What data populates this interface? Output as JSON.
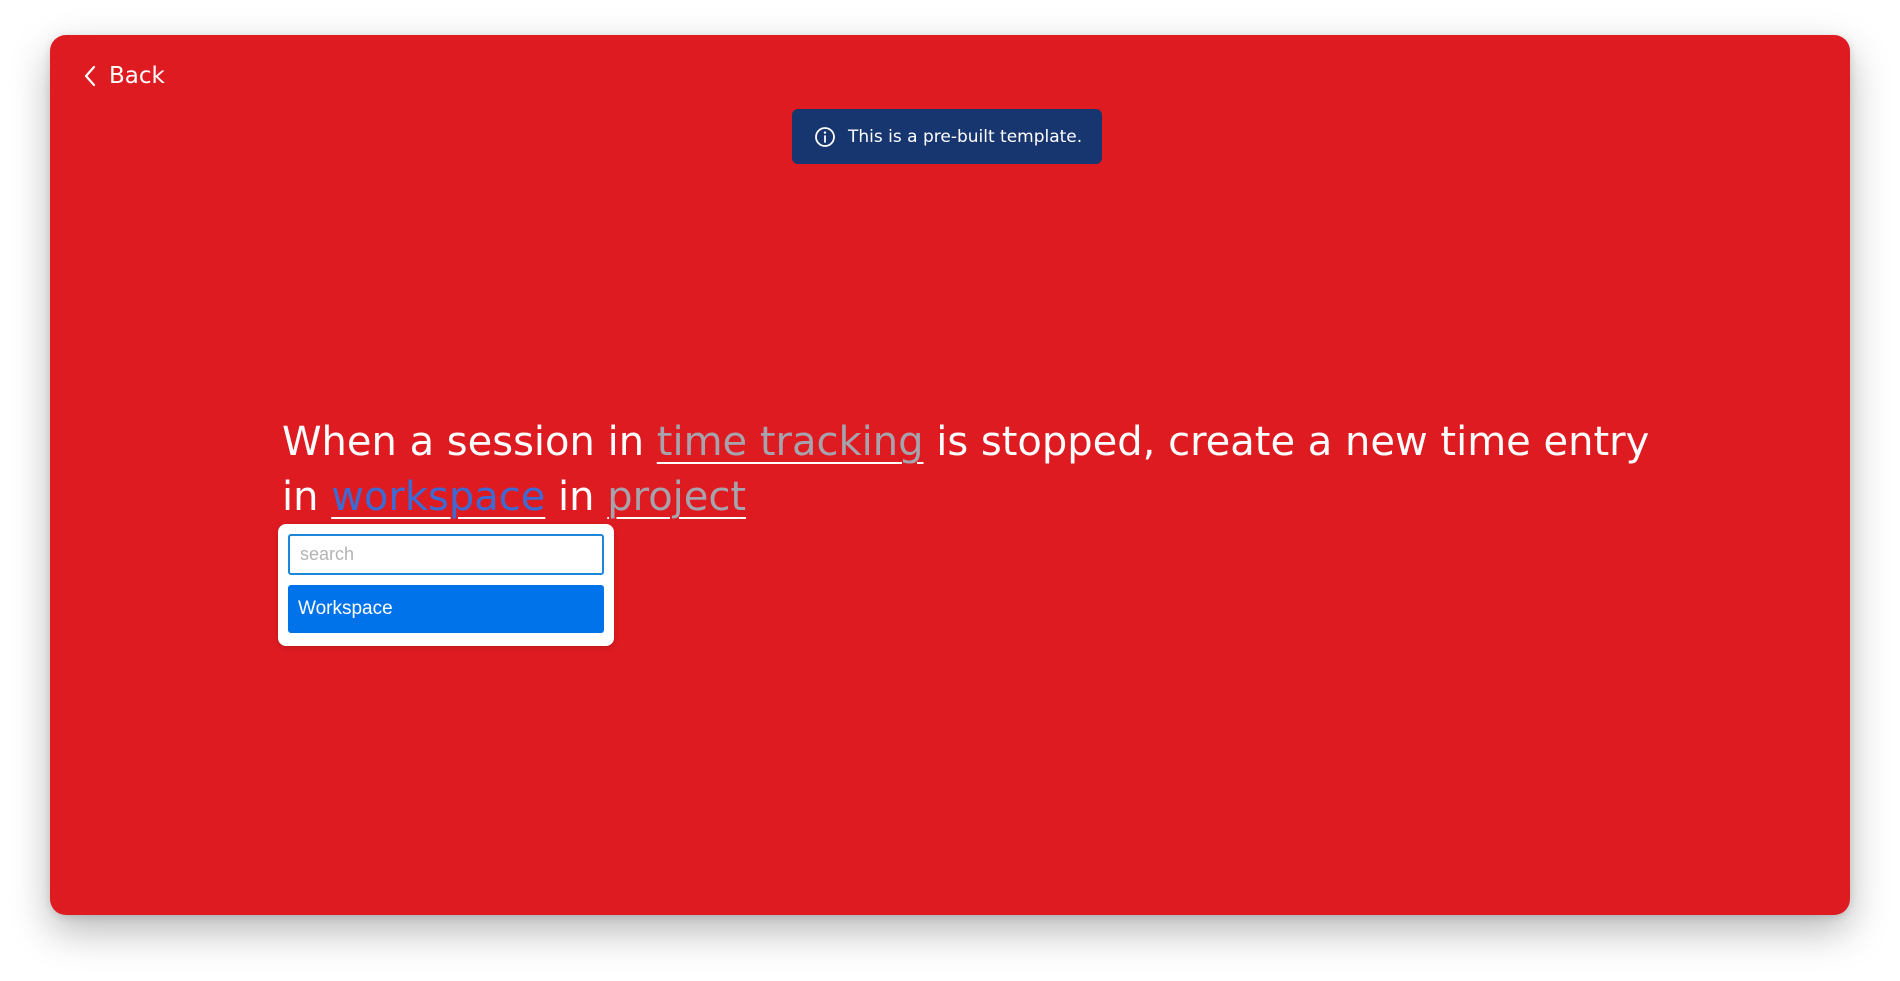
{
  "colors": {
    "modal_bg": "#df1b22",
    "banner_bg": "#17356f",
    "slot_inactive": "#a6a3ad",
    "slot_active": "#3b6bd3",
    "option_selected_bg": "#0073ea"
  },
  "back": {
    "label": "Back",
    "icon": "chevron-left-icon"
  },
  "banner": {
    "icon": "info-icon",
    "text": "This is a pre-built template."
  },
  "sentence": {
    "part1": "When a session in ",
    "slot_time_tracking": "time tracking",
    "part2": " is stopped, create a new time entry in ",
    "slot_workspace": "workspace",
    "part3": " in ",
    "slot_project": "project"
  },
  "dropdown": {
    "search_placeholder": "search",
    "search_value": "",
    "options": [
      {
        "label": "Workspace",
        "selected": true
      }
    ]
  }
}
